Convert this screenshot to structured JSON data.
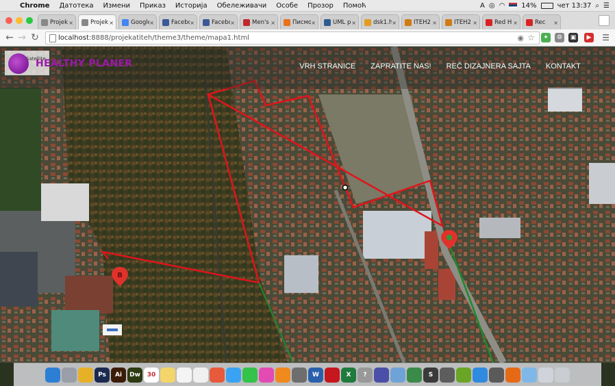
{
  "menubar": {
    "app_name": "Chrome",
    "items": [
      "Датотека",
      "Измени",
      "Приказ",
      "Историја",
      "Обележивачи",
      "Особе",
      "Прозор",
      "Помоћ"
    ],
    "battery": "14%",
    "clock": "чет 13:37"
  },
  "tabs": [
    {
      "label": "Projek",
      "icon": "globe-icon",
      "active": false
    },
    {
      "label": "Projek",
      "icon": "globe-icon",
      "active": true
    },
    {
      "label": "Google",
      "icon": "google-icon",
      "active": false
    },
    {
      "label": "Facebo",
      "icon": "facebook-icon",
      "active": false
    },
    {
      "label": "Facebo",
      "icon": "facebook-icon",
      "active": false
    },
    {
      "label": "Men's",
      "icon": "mens-icon",
      "active": false
    },
    {
      "label": "Писмо",
      "icon": "mail-icon",
      "active": false
    },
    {
      "label": "UML p",
      "icon": "uml-icon",
      "active": false
    },
    {
      "label": "dsk1.h",
      "icon": "bookmark-icon",
      "active": false
    },
    {
      "label": "ITEH2",
      "icon": "iteh-icon",
      "active": false
    },
    {
      "label": "ITEH2",
      "icon": "iteh-icon",
      "active": false
    },
    {
      "label": "Red H",
      "icon": "youtube-icon",
      "active": false
    },
    {
      "label": "Rec",
      "icon": "youtube-icon",
      "active": false
    }
  ],
  "toolbar": {
    "url_host": "localhost",
    "url_rest": ":8888/projekatiteh/theme3/theme/mapa1.html"
  },
  "site": {
    "logo_text": "Satellite",
    "brand": "HEALTHY PLANER",
    "nav": [
      "VRH STRANICE",
      "ZAPRATITE NAS!",
      "REČ DIZAJNERA SAJTA",
      "KONTAKT"
    ]
  },
  "map": {
    "marker_b_label": "B",
    "route_color": "#e0141b",
    "path_color": "#1e8a2a"
  },
  "colors": {
    "brand": "#9b19a8",
    "route": "#e0141b"
  },
  "dock": [
    {
      "name": "finder-icon",
      "color": "#2d7fd6",
      "glyph": ""
    },
    {
      "name": "launchpad-icon",
      "color": "#9a9ea8",
      "glyph": ""
    },
    {
      "name": "chrome-icon",
      "color": "#e6b126",
      "glyph": ""
    },
    {
      "name": "photoshop-icon",
      "color": "#1a2a50",
      "glyph": "Ps"
    },
    {
      "name": "illustrator-icon",
      "color": "#3b1c06",
      "glyph": "Ai"
    },
    {
      "name": "dreamweaver-icon",
      "color": "#2d3a12",
      "glyph": "Dw"
    },
    {
      "name": "calendar-icon",
      "color": "#ffffff",
      "glyph": "30"
    },
    {
      "name": "notes-icon",
      "color": "#f3d56a",
      "glyph": ""
    },
    {
      "name": "reminders-icon",
      "color": "#f4f4f4",
      "glyph": ""
    },
    {
      "name": "photos-icon",
      "color": "#f0f0f0",
      "glyph": ""
    },
    {
      "name": "photos-color-icon",
      "color": "#e85a3c",
      "glyph": ""
    },
    {
      "name": "messages-icon",
      "color": "#3aa2f2",
      "glyph": ""
    },
    {
      "name": "facetime-icon",
      "color": "#33c24a",
      "glyph": ""
    },
    {
      "name": "itunes-icon",
      "color": "#e34bb3",
      "glyph": ""
    },
    {
      "name": "ibooks-icon",
      "color": "#f08a1c",
      "glyph": ""
    },
    {
      "name": "system-preferences-icon",
      "color": "#6e6e6e",
      "glyph": ""
    },
    {
      "name": "word-icon",
      "color": "#2a5fab",
      "glyph": "W"
    },
    {
      "name": "filezilla-icon",
      "color": "#c6161e",
      "glyph": ""
    },
    {
      "name": "excel-icon",
      "color": "#1f7a3e",
      "glyph": "X"
    },
    {
      "name": "help-icon",
      "color": "#999999",
      "glyph": "?"
    },
    {
      "name": "disk-icon",
      "color": "#4b4fa8",
      "glyph": ""
    },
    {
      "name": "virtualbox-icon",
      "color": "#6fa3d8",
      "glyph": ""
    },
    {
      "name": "paintbrush-icon",
      "color": "#3a8a4a",
      "glyph": ""
    },
    {
      "name": "sublime-icon",
      "color": "#3a3a3a",
      "glyph": "S"
    },
    {
      "name": "mamp-icon",
      "color": "#5d5d5d",
      "glyph": ""
    },
    {
      "name": "utorrent-icon",
      "color": "#6aa526",
      "glyph": ""
    },
    {
      "name": "safari-icon",
      "color": "#2f8ae0",
      "glyph": ""
    },
    {
      "name": "sequel-icon",
      "color": "#5a5a5a",
      "glyph": ""
    },
    {
      "name": "firefox-icon",
      "color": "#e66a16",
      "glyph": ""
    },
    {
      "name": "folder-icon",
      "color": "#7fb8e8",
      "glyph": ""
    },
    {
      "name": "downloads-icon",
      "color": "#d0d4da",
      "glyph": ""
    },
    {
      "name": "trash-icon",
      "color": "#c9ccd1",
      "glyph": ""
    }
  ]
}
